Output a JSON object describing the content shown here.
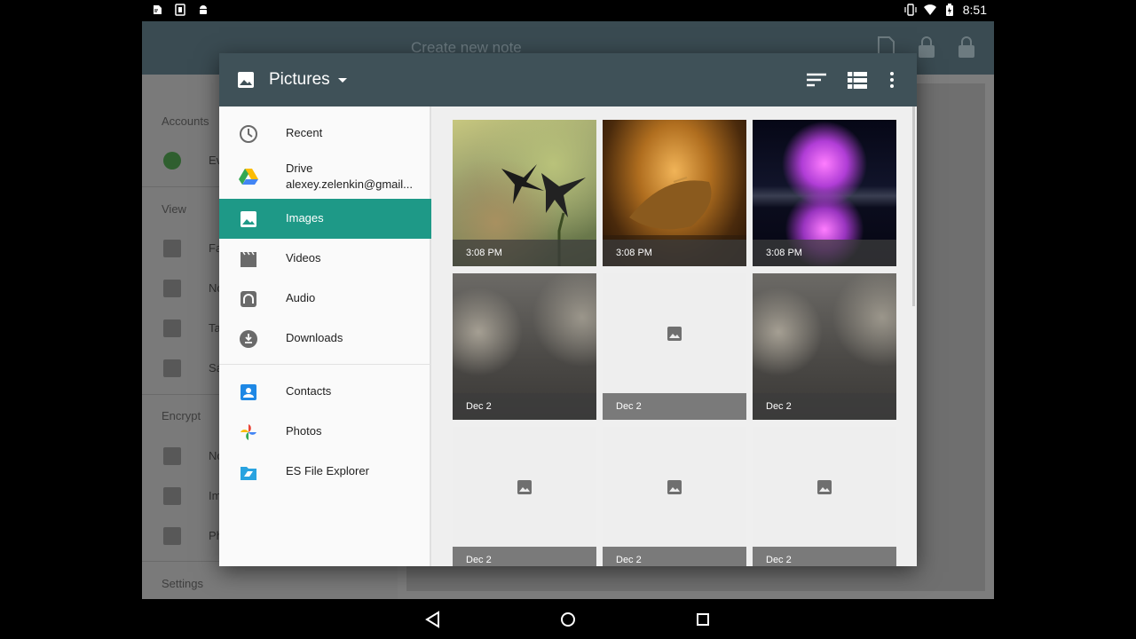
{
  "status_bar": {
    "time": "8:51",
    "left_icons": [
      "evernote-icon",
      "sim-icon",
      "android-icon"
    ],
    "right_icons": [
      "vibrate-icon",
      "wifi-icon",
      "battery-icon"
    ]
  },
  "background_app": {
    "toolbar_title": "Create new note",
    "drawer_sections": [
      "Accounts",
      "View",
      "Encrypt",
      "Settings"
    ],
    "drawer_items": [
      "Ev",
      "Fa",
      "No",
      "Ta",
      "Sa",
      "No",
      "Im",
      "Ph"
    ]
  },
  "picker": {
    "title": "Pictures",
    "toolbar_actions": [
      "sort-icon",
      "list-view-icon",
      "overflow-menu-icon"
    ],
    "roots": [
      {
        "label": "Recent",
        "icon": "clock-icon"
      },
      {
        "label": "Drive",
        "sublabel": "alexey.zelenkin@gmail...",
        "icon": "drive-icon"
      },
      {
        "label": "Images",
        "icon": "image-icon",
        "selected": true
      },
      {
        "label": "Videos",
        "icon": "video-icon"
      },
      {
        "label": "Audio",
        "icon": "audio-icon"
      },
      {
        "label": "Downloads",
        "icon": "download-icon"
      },
      {
        "label": "Contacts",
        "icon": "contacts-icon"
      },
      {
        "label": "Photos",
        "icon": "photos-icon"
      },
      {
        "label": "ES File Explorer",
        "icon": "es-file-explorer-icon"
      }
    ],
    "tiles": [
      {
        "caption": "3:08 PM",
        "kind": "birds"
      },
      {
        "caption": "3:08 PM",
        "kind": "leaf"
      },
      {
        "caption": "3:08 PM",
        "kind": "space"
      },
      {
        "caption": "Dec 2",
        "kind": "blur"
      },
      {
        "caption": "Dec 2",
        "kind": "placeholder"
      },
      {
        "caption": "Dec 2",
        "kind": "blur"
      },
      {
        "caption": "Dec 2",
        "kind": "placeholder"
      },
      {
        "caption": "Dec 2",
        "kind": "placeholder"
      },
      {
        "caption": "Dec 2",
        "kind": "placeholder"
      }
    ]
  },
  "colors": {
    "toolbar": "#3f5158",
    "selected_root": "#1e9987"
  }
}
